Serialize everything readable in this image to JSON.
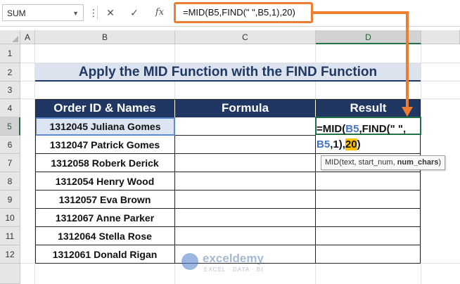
{
  "formula_bar": {
    "name_box": "SUM",
    "cancel_icon": "✕",
    "enter_icon": "✓",
    "fx_label": "fx",
    "formula": "=MID(B5,FIND(\" \",B5,1),20)"
  },
  "columns": [
    "A",
    "B",
    "C",
    "D"
  ],
  "rows": [
    "1",
    "2",
    "3",
    "4",
    "5",
    "6",
    "7",
    "8",
    "9",
    "10",
    "11",
    "12"
  ],
  "title": "Apply the MID Function with the FIND Function",
  "table": {
    "headers": [
      "Order ID & Names",
      "Formula",
      "Result"
    ],
    "rows": [
      "1312045 Juliana Gomes",
      "1312047 Patrick Gomes",
      "1312058 Roberk Derick",
      "1312054 Henry Wood",
      "1312057 Eva Brown",
      "1312067 Anne Parker",
      "1312064 Stella Rose",
      "1312061 Donald Rigan"
    ]
  },
  "edit_cell": {
    "line1_prefix": "=MID(",
    "line1_ref": "B5",
    "line1_suffix": ",FIND(\" \",",
    "line2_ref": "B5",
    "line2_mid": ",1),",
    "line2_highlight": "20",
    "line2_suffix": ")"
  },
  "tooltip": {
    "prefix": "MID(text, start_num, ",
    "bold": "num_chars",
    "suffix": ")"
  },
  "watermark": {
    "name": "exceldemy",
    "tagline": "EXCEL · DATA · BI"
  },
  "colors": {
    "accent_orange": "#ed7d31",
    "header_navy": "#203764",
    "title_fill": "#dde3ee",
    "excel_green": "#217346"
  }
}
